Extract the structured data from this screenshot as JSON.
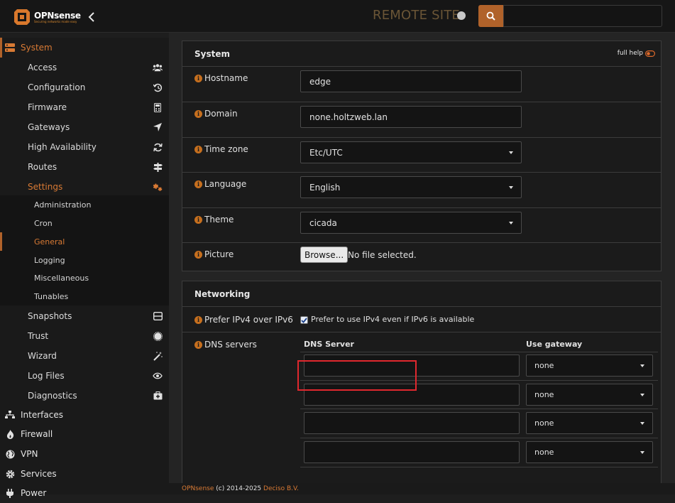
{
  "header": {
    "brand_name": "OPNsense",
    "brand_tagline": "Securing networks made easy",
    "site_label": "REMOTE SITE",
    "search_value": ""
  },
  "sidebar": {
    "system": "System",
    "system_items": [
      {
        "label": "Access",
        "icon": "users-icon"
      },
      {
        "label": "Configuration",
        "icon": "history-icon"
      },
      {
        "label": "Firmware",
        "icon": "calculator-icon"
      },
      {
        "label": "Gateways",
        "icon": "location-arrow-icon"
      },
      {
        "label": "High Availability",
        "icon": "refresh-icon"
      },
      {
        "label": "Routes",
        "icon": "signpost-icon"
      },
      {
        "label": "Settings",
        "icon": "cogs-icon"
      }
    ],
    "settings_items": [
      "Administration",
      "Cron",
      "General",
      "Logging",
      "Miscellaneous",
      "Tunables"
    ],
    "system_items_2": [
      {
        "label": "Snapshots",
        "icon": "hdd-icon"
      },
      {
        "label": "Trust",
        "icon": "certificate-icon"
      },
      {
        "label": "Wizard",
        "icon": "magic-icon"
      },
      {
        "label": "Log Files",
        "icon": "eye-icon"
      },
      {
        "label": "Diagnostics",
        "icon": "medkit-icon"
      }
    ],
    "top_items": [
      {
        "label": "Interfaces",
        "icon": "sitemap-icon"
      },
      {
        "label": "Firewall",
        "icon": "fire-icon"
      },
      {
        "label": "VPN",
        "icon": "globe-icon"
      },
      {
        "label": "Services",
        "icon": "cog-icon"
      },
      {
        "label": "Power",
        "icon": "plug-icon"
      }
    ]
  },
  "system_panel": {
    "title": "System",
    "full_help": "full help",
    "hostname_label": "Hostname",
    "hostname_value": "edge",
    "domain_label": "Domain",
    "domain_value": "none.holtzweb.lan",
    "timezone_label": "Time zone",
    "timezone_value": "Etc/UTC",
    "language_label": "Language",
    "language_value": "English",
    "theme_label": "Theme",
    "theme_value": "cicada",
    "picture_label": "Picture",
    "browse_label": "Browse...",
    "no_file": "No file selected."
  },
  "networking_panel": {
    "title": "Networking",
    "prefer_label": "Prefer IPv4 over IPv6",
    "prefer_checkbox_label": "Prefer to use IPv4 even if IPv6 is available",
    "prefer_checked": true,
    "dns_label": "DNS servers",
    "dns_col_server": "DNS Server",
    "dns_col_gateway": "Use gateway",
    "dns_rows": [
      {
        "server": "",
        "gateway": "none"
      },
      {
        "server": "",
        "gateway": "none"
      },
      {
        "server": "",
        "gateway": "none"
      },
      {
        "server": "",
        "gateway": "none"
      }
    ]
  },
  "footer": {
    "brand": "OPNsense",
    "copyright": " (c) 2014-2025 ",
    "company": "Deciso B.V."
  },
  "colors": {
    "accent": "#d97a34",
    "accent_dark": "#b0622a",
    "highlight": "#e0282e"
  }
}
